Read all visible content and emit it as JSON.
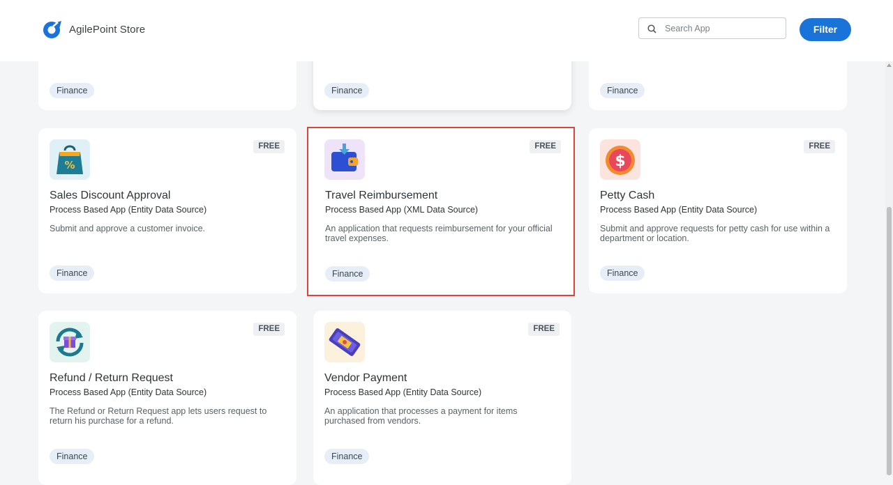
{
  "header": {
    "brand": "AgilePoint Store",
    "search_placeholder": "Search App",
    "search_value": "",
    "filter_label": "Filter"
  },
  "colors": {
    "accent": "#1a73d9",
    "selection_outline": "#e0433a",
    "tag_bg": "#e7eef7"
  },
  "top_row": [
    {
      "tag": "Finance"
    },
    {
      "tag": "Finance"
    },
    {
      "tag": "Finance"
    }
  ],
  "cards": [
    {
      "icon": "shopping-bag-percent-icon",
      "badge": "FREE",
      "title": "Sales Discount Approval",
      "type": "Process Based App (Entity Data Source)",
      "description": "Submit and approve a customer invoice.",
      "tag": "Finance"
    },
    {
      "icon": "wallet-arrow-icon",
      "badge": "FREE",
      "title": "Travel Reimbursement",
      "type": "Process Based App (XML Data Source)",
      "description": "An application that requests reimbursement for your official travel expenses.",
      "tag": "Finance",
      "selected": true
    },
    {
      "icon": "dollar-coin-icon",
      "badge": "FREE",
      "title": "Petty Cash",
      "type": "Process Based App (Entity Data Source)",
      "description": "Submit and approve requests for petty cash for use within a department or location.",
      "tag": "Finance"
    },
    {
      "icon": "gift-refresh-icon",
      "badge": "FREE",
      "title": "Refund / Return Request",
      "type": "Process Based App (Entity Data Source)",
      "description": "The Refund or Return Request app lets users request to return his purchase for a refund.",
      "tag": "Finance"
    },
    {
      "icon": "cash-bills-icon",
      "badge": "FREE",
      "title": "Vendor Payment",
      "type": "Process Based App (Entity Data Source)",
      "description": "An application that processes a payment for items purchased from vendors.",
      "tag": "Finance"
    }
  ]
}
